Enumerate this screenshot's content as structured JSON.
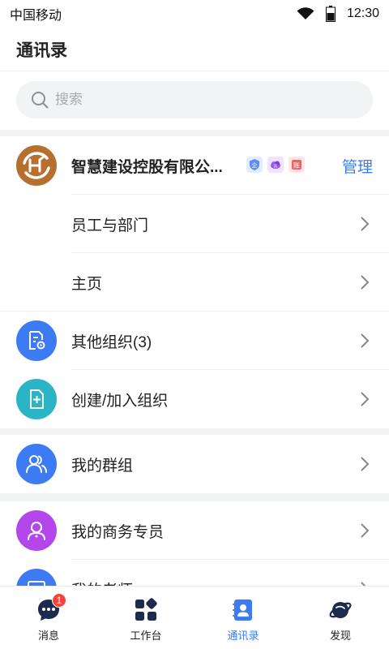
{
  "status": {
    "carrier": "中国移动",
    "time": "12:30"
  },
  "header": {
    "title": "通讯录"
  },
  "search": {
    "placeholder": "搜索"
  },
  "company": {
    "name": "智慧建设控股有限公...",
    "manage_label": "管理",
    "badges": [
      "企",
      "云",
      "账"
    ]
  },
  "company_items": [
    {
      "label": "员工与部门"
    },
    {
      "label": "主页"
    }
  ],
  "org_items": [
    {
      "label": "其他组织(3)",
      "icon": "org-document-gear-icon"
    },
    {
      "label": "创建/加入组织",
      "icon": "create-document-plus-icon"
    }
  ],
  "groups": {
    "label": "我的群组",
    "icon": "people-icon"
  },
  "other_items": [
    {
      "label": "我的商务专员",
      "icon": "assistant-icon"
    },
    {
      "label": "我的老师",
      "icon": "teacher-icon"
    }
  ],
  "tabbar": {
    "tabs": [
      {
        "label": "消息",
        "icon": "message-icon",
        "badge": "1"
      },
      {
        "label": "工作台",
        "icon": "workbench-icon"
      },
      {
        "label": "通讯录",
        "icon": "contacts-icon",
        "active": true
      },
      {
        "label": "发现",
        "icon": "discover-planet-icon"
      }
    ]
  },
  "colors": {
    "accent": "#3d7bf5",
    "company_logo": "#b5702f",
    "org_blue": "#3d7bf5",
    "create_teal": "#2bb3c6",
    "groups_blue": "#3d7bf5",
    "assistant_purple": "#b347ea",
    "badge_red": "#f5443b"
  }
}
